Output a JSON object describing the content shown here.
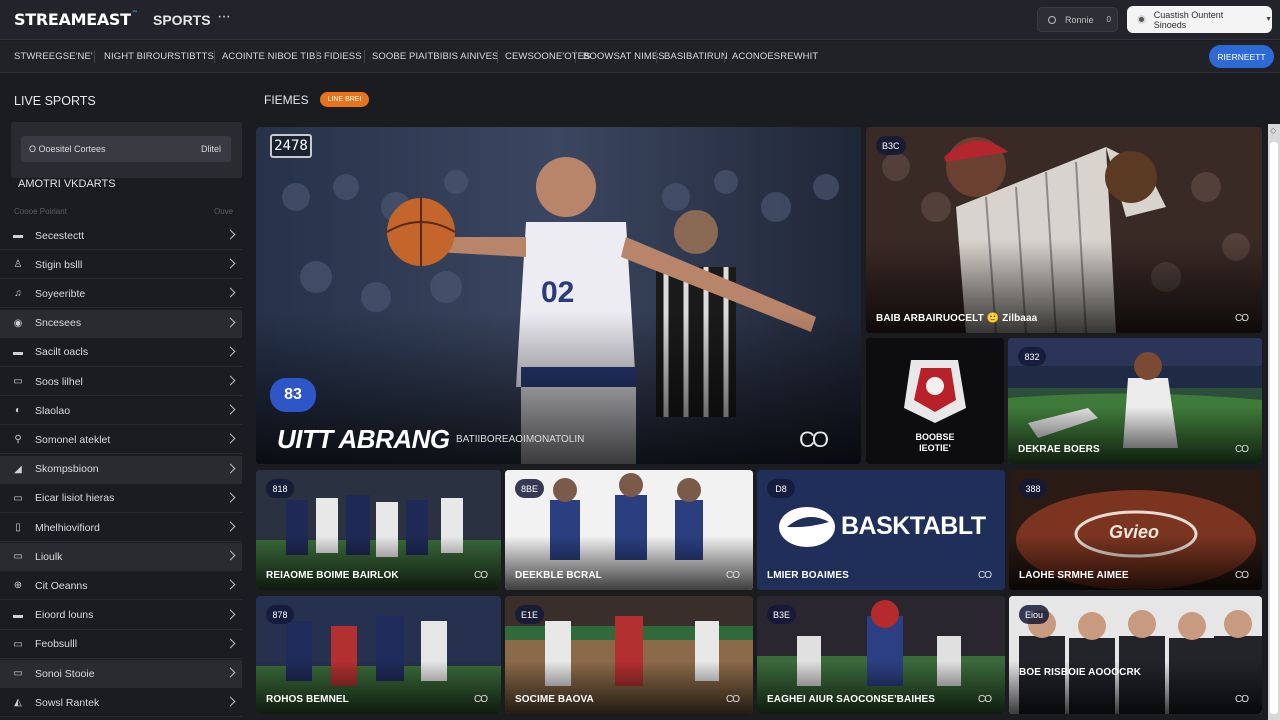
{
  "header": {
    "logo_text": "STREAMEAST",
    "logo_mark": "™",
    "brand_label": "SPORTS",
    "more_icon": "···",
    "search_label": "Ronnie",
    "search_clear": "0",
    "account_label": "Cuastish Ountent Sinoeds",
    "account_caret": "▼"
  },
  "catnav": {
    "items": [
      "STWREEGSE'NE'  ",
      "NIGHT BIROURSTIBTTS",
      "ACOINTE NIBOE TIBS",
      "FIDIESS",
      "SOOBE PIAITBIBIS AINIVES",
      "CEWSOONE'OTES",
      "BOOWSAT NIMBS",
      "BASIBATIRUN",
      "ACONOESREWHIT"
    ],
    "register_label": "RIERNEETT"
  },
  "sidebar": {
    "title": "LIVE SPORTS",
    "filter_label": "O Ooesitel Cortees",
    "filter_action": "Dlitel",
    "subtitle": "AMOTRI VKDARTS",
    "col_left": "Coooe Poiriant",
    "col_right": "Ouve",
    "items": [
      {
        "icon": "▬",
        "label": "Secestectt"
      },
      {
        "icon": "♙",
        "label": "Stigin bslll"
      },
      {
        "icon": "♫",
        "label": "Soyeeribte"
      },
      {
        "icon": "◉",
        "label": "Sncesees"
      },
      {
        "icon": "▬",
        "label": "Sacilt oacls"
      },
      {
        "icon": "▭",
        "label": "Soos lilhel"
      },
      {
        "icon": "◐",
        "label": "Slaolao"
      },
      {
        "icon": "⚲",
        "label": "Somonel ateklet"
      },
      {
        "icon": "◢",
        "label": "Skompsbioon"
      },
      {
        "icon": "▭",
        "label": "Eicar lisiot hieras"
      },
      {
        "icon": "▯",
        "label": "Mhelhiovifiord"
      },
      {
        "icon": "▭",
        "label": "Lioulk"
      },
      {
        "icon": "⊕",
        "label": "Cit Oeanns"
      },
      {
        "icon": "▬",
        "label": "Eioord louns"
      },
      {
        "icon": "▭",
        "label": "Feobsulll"
      },
      {
        "icon": "▭",
        "label": "Sonoi Stooie"
      },
      {
        "icon": "◭",
        "label": "Sowsl Rantek"
      }
    ]
  },
  "main": {
    "title": "FIEMES",
    "live_badge": "LINE BREI",
    "featured": {
      "tag": "2478",
      "score": "83",
      "title": "UITT ABRANG",
      "subtitle": "BATIIBOREAOIMONATOLIN",
      "cc": "CO"
    },
    "cards": [
      {
        "tag": "B3C",
        "title": "BAIB ARBAIRUOCELT   🙂   Zilbaaa",
        "cc": "CO"
      },
      {
        "tag": "",
        "title": "BOOBSE\nIEOTIE'",
        "cc": ""
      },
      {
        "tag": "832",
        "title": "DEKRAE BOERS",
        "cc": "CO"
      },
      {
        "tag": "818",
        "title": "REIAOME BOIME BAIRLOK",
        "cc": "CO"
      },
      {
        "tag": "8BE",
        "title": "DEEKBLE BCRAL",
        "cc": "CO"
      },
      {
        "tag": "D8",
        "title": "LMIER BOAIMES",
        "cc": "CO"
      },
      {
        "tag": "388",
        "title": "LAOHE SRMHE AIMEE",
        "cc": "CO"
      },
      {
        "tag": "878",
        "title": "ROHOS BEMNEL",
        "cc": "CO"
      },
      {
        "tag": "E1E",
        "title": "SOCIME BAOVA",
        "cc": "CO"
      },
      {
        "tag": "B3E",
        "title": "EAGHEI AIUR SAOCONSE'BAIHES",
        "cc": "CO"
      },
      {
        "tag": "Eiou",
        "title": "BOE RISBOIE AOOOCRK",
        "cc": "CO"
      }
    ],
    "banner_text": "BASKTABLT",
    "ball_text": "Gvieo"
  },
  "colors": {
    "accent_blue": "#2e6ad6",
    "live_orange": "#e8731a",
    "background": "#1b1c20"
  }
}
